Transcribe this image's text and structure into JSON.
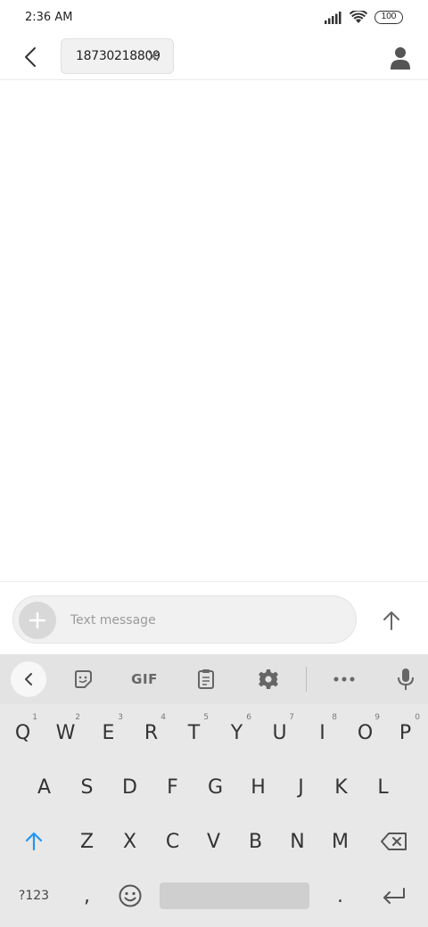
{
  "status_bar": {
    "time": "2:36 AM",
    "battery": "100",
    "icons": [
      "signal-icon",
      "wifi-icon",
      "battery-icon"
    ]
  },
  "header": {
    "back_icon": "back-arrow-icon",
    "recipient": "18730218809",
    "recipient_remove_icon": "close-icon",
    "contact_icon": "person-icon"
  },
  "compose": {
    "attach_icon": "plus-icon",
    "placeholder": "Text message",
    "value": "",
    "send_icon": "arrow-up-icon"
  },
  "keyboard": {
    "toolbar": {
      "collapse_icon": "chevron-left-icon",
      "sticker_icon": "sticker-icon",
      "gif_label": "GIF",
      "clipboard_icon": "clipboard-icon",
      "settings_icon": "gear-icon",
      "more_icon": "more-horizontal-icon",
      "mic_icon": "microphone-icon"
    },
    "row1": [
      {
        "label": "Q",
        "hint": "1"
      },
      {
        "label": "W",
        "hint": "2"
      },
      {
        "label": "E",
        "hint": "3"
      },
      {
        "label": "R",
        "hint": "4"
      },
      {
        "label": "T",
        "hint": "5"
      },
      {
        "label": "Y",
        "hint": "6"
      },
      {
        "label": "U",
        "hint": "7"
      },
      {
        "label": "I",
        "hint": "8"
      },
      {
        "label": "O",
        "hint": "9"
      },
      {
        "label": "P",
        "hint": "0"
      }
    ],
    "row2": [
      "A",
      "S",
      "D",
      "F",
      "G",
      "H",
      "J",
      "K",
      "L"
    ],
    "row3": [
      "Z",
      "X",
      "C",
      "V",
      "B",
      "N",
      "M"
    ],
    "shift_icon": "shift-arrow-icon",
    "backspace_icon": "backspace-icon",
    "symbols_label": "?123",
    "comma": ",",
    "emoji_icon": "emoji-icon",
    "period": ".",
    "enter_icon": "enter-icon",
    "accent_color": "#2196f3"
  }
}
